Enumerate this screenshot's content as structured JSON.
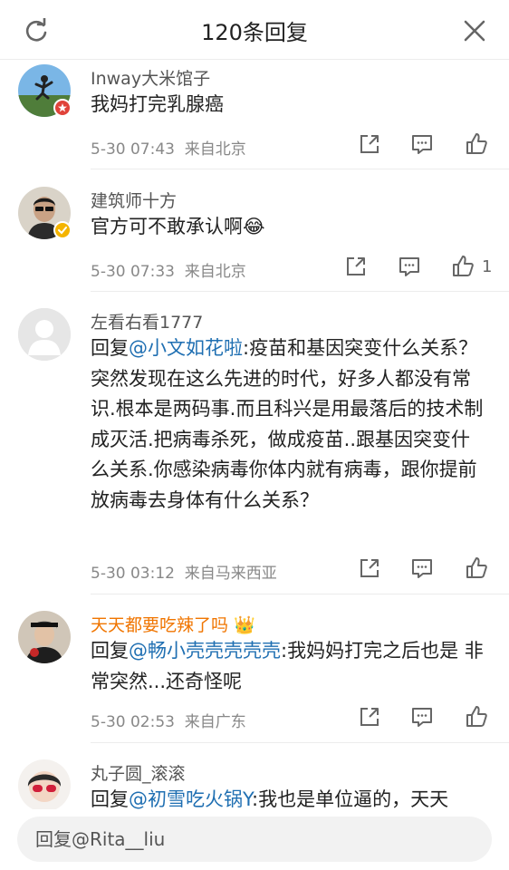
{
  "header": {
    "title": "120条回复",
    "refresh_icon": "refresh-icon",
    "close_icon": "close-icon"
  },
  "comments": [
    {
      "username": "Inway大米馆子",
      "text": "我妈打完乳腺癌",
      "time": "5-30 07:43",
      "source": "来自北京",
      "likes": ""
    },
    {
      "username": "建筑师十方",
      "text": "官方可不敢承认啊",
      "emoji": "😂",
      "time": "5-30 07:33",
      "source": "来自北京",
      "likes": "1"
    },
    {
      "username": "左看右看1777",
      "reply_prefix": "回复",
      "mention": "@小文如花啦",
      "text": ":疫苗和基因突变什么关系？突然发现在这么先进的时代，好多人都没有常识.根本是两码事.而且科兴是用最落后的技术制成灭活.把病毒杀死，做成疫苗..跟基因突变什么关系.你感染病毒你体内就有病毒，跟你提前放病毒去身体有什么关系？",
      "time": "5-30 03:12",
      "source": "来自马来西亚",
      "likes": ""
    },
    {
      "username": "天天都要吃辣了吗",
      "crown_icon": "👑",
      "reply_prefix": "回复",
      "mention": "@畅小壳壳壳壳壳",
      "text": ":我妈妈打完之后也是 非常突然...还奇怪呢",
      "time": "5-30 02:53",
      "source": "来自广东",
      "likes": ""
    },
    {
      "username": "丸子圆_滚滚",
      "reply_prefix": "回复",
      "mention": "@初雪吃火锅Y",
      "text": ":我也是单位逼的，天天"
    }
  ],
  "footer": {
    "reply_placeholder": "回复@Rita__liu"
  },
  "colors": {
    "mention": "#1f6fb2",
    "vip_name": "#f07500",
    "badge_red": "#e0433a",
    "badge_gold": "#f4b400"
  }
}
